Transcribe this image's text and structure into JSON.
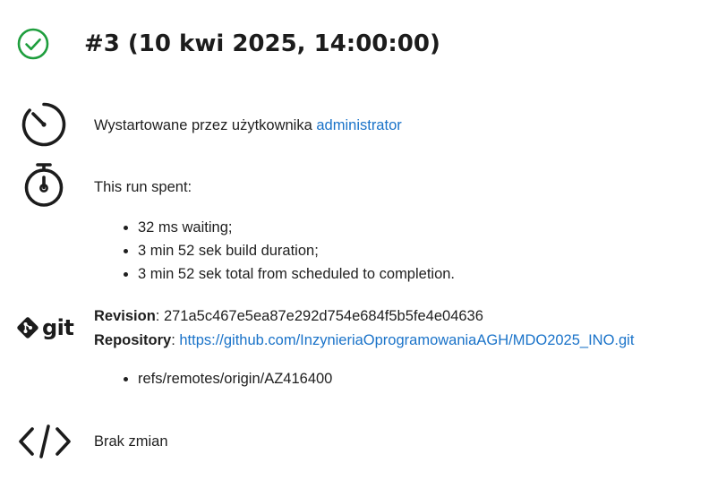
{
  "header": {
    "status_icon": "check-circle-icon",
    "status_color": "#1e9e3d",
    "title": "#3 (10 kwi 2025, 14:00:00)"
  },
  "started_by": {
    "icon": "clock-start-icon",
    "text": "Wystartowane przez użytkownika ",
    "user_link": "administrator"
  },
  "timing": {
    "icon": "stopwatch-icon",
    "heading": "This run spent:",
    "items": [
      "32 ms waiting;",
      "3 min 52 sek build duration;",
      "3 min 52 sek total from scheduled to completion."
    ]
  },
  "git": {
    "icon": "git-logo-icon",
    "logo_text": "git",
    "revision_label": "Revision",
    "revision_value": ": 271a5c467e5ea87e292d754e684f5b5fe4e04636",
    "repository_label": "Repository",
    "repository_sep": ": ",
    "repository_link": "https://github.com/InzynieriaOprogramowaniaAGH/MDO2025_INO.git",
    "refs": [
      "refs/remotes/origin/AZ416400"
    ]
  },
  "changes": {
    "icon": "code-icon",
    "text": "Brak zmian"
  },
  "colors": {
    "link": "#1a73c9",
    "text": "#1f1f1f",
    "success": "#1e9e3d"
  }
}
